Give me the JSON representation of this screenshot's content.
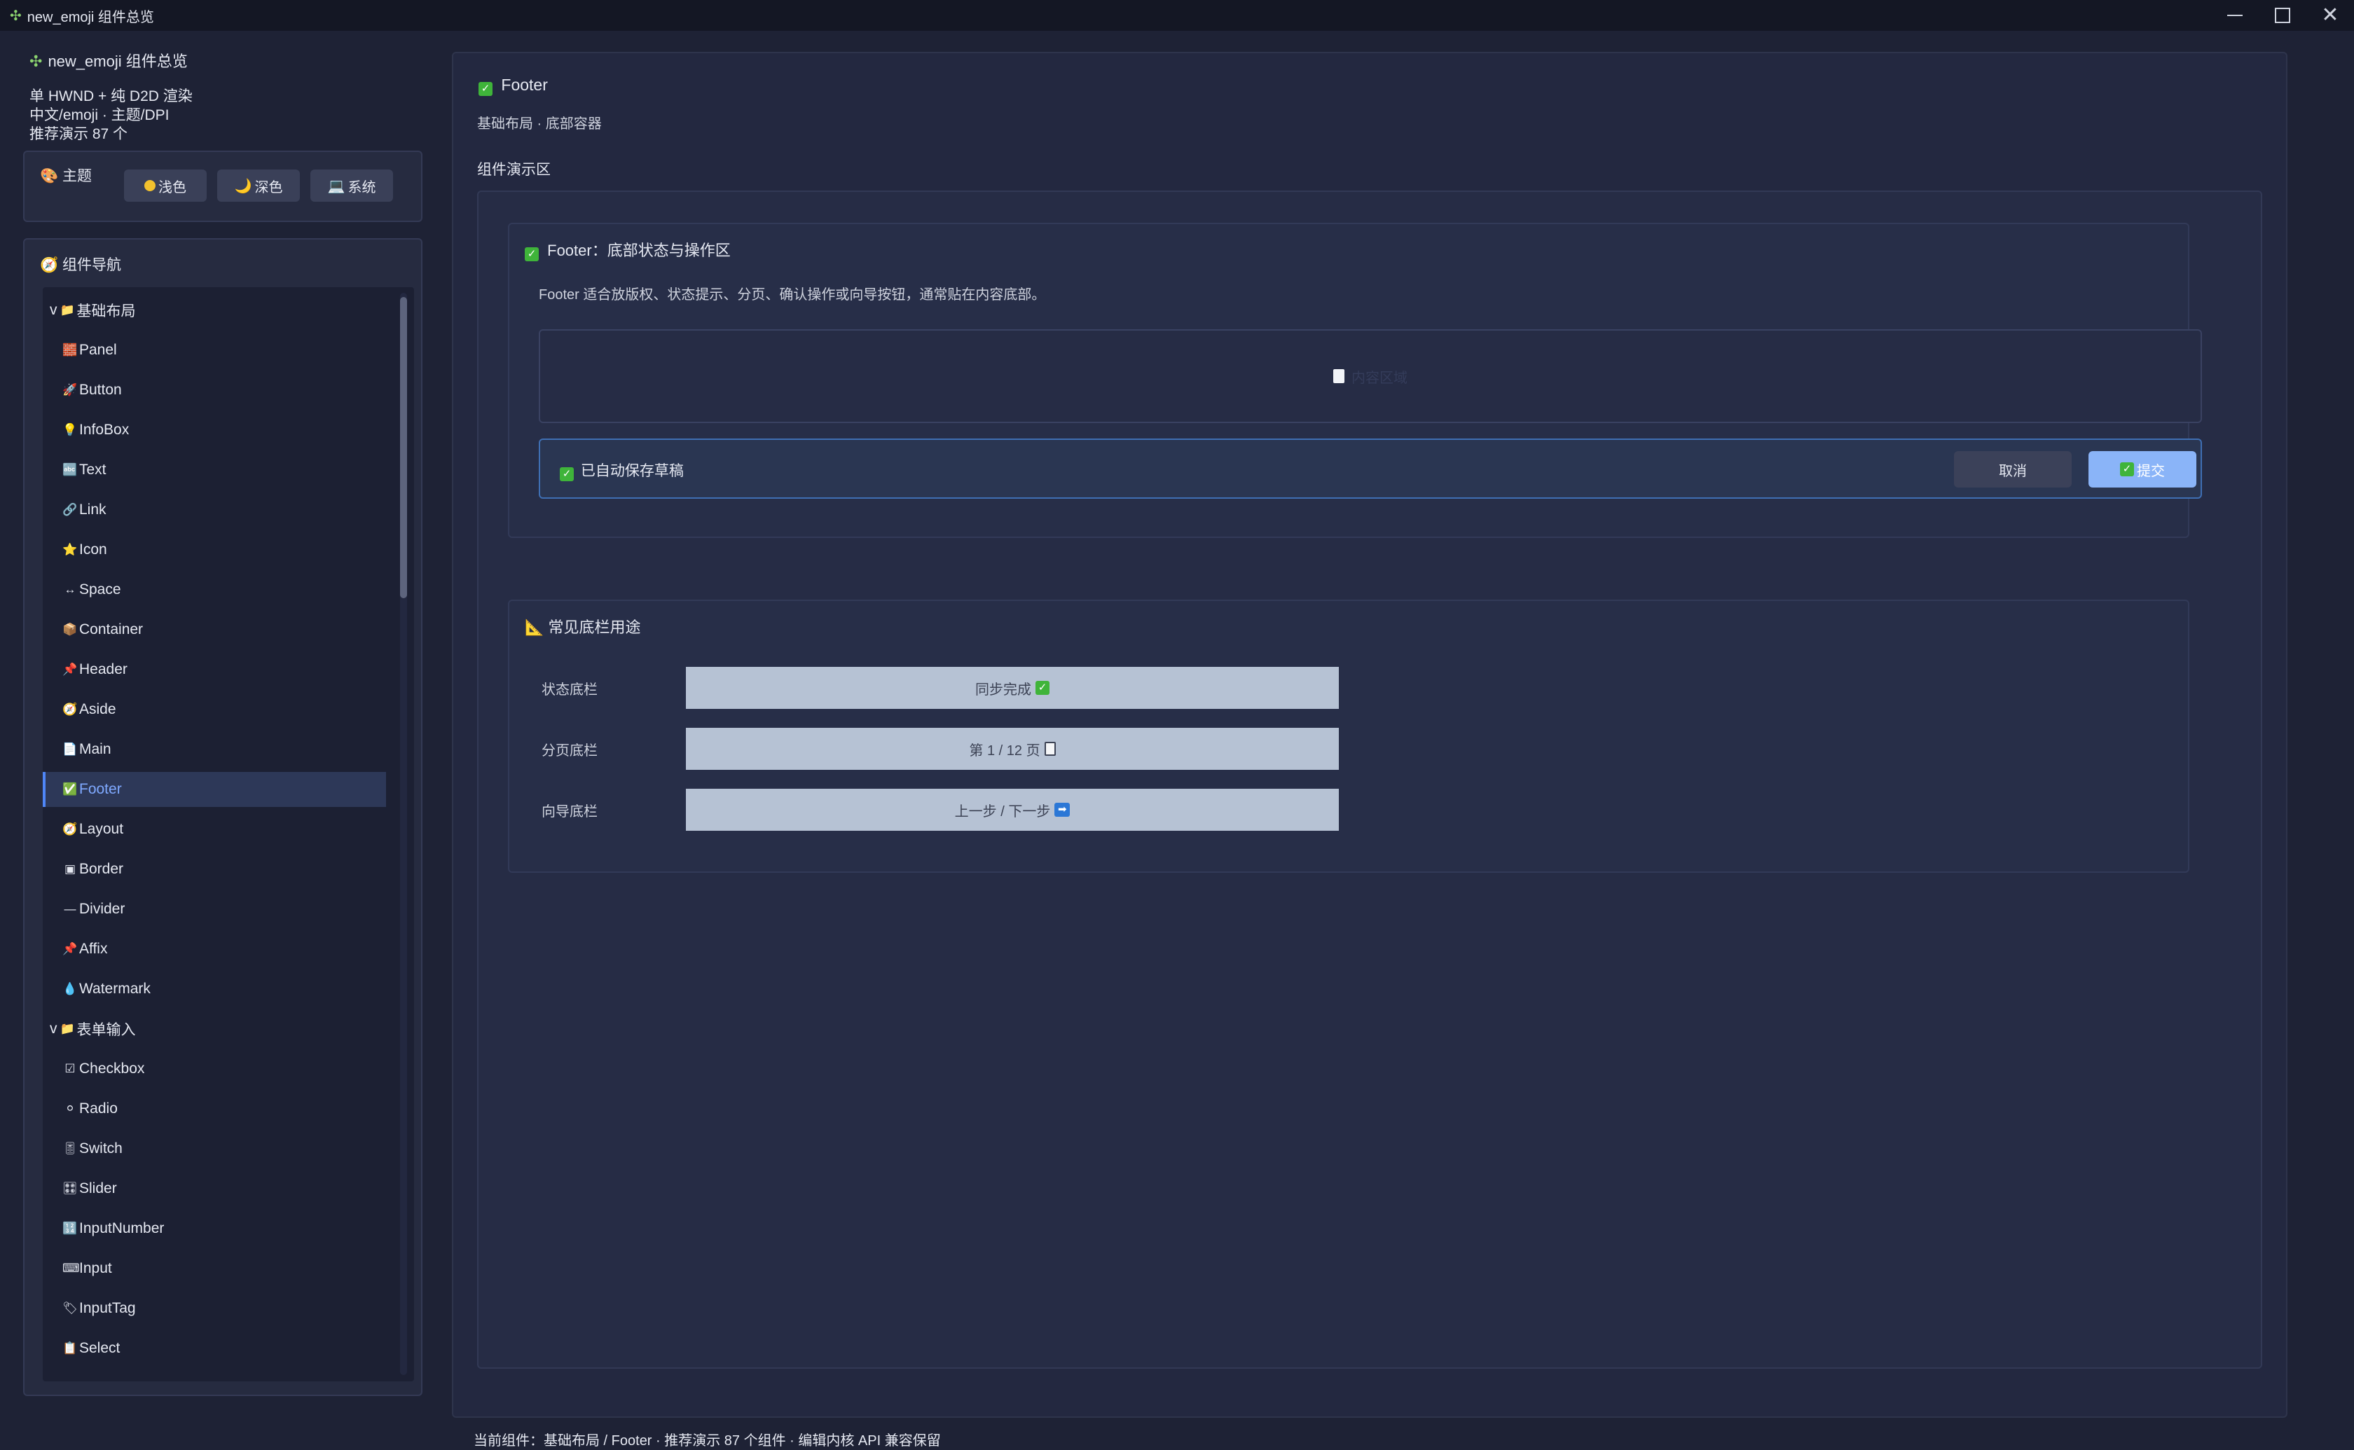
{
  "window": {
    "title": "new_emoji 组件总览",
    "app_icon": "puzzle-icon"
  },
  "sidebar": {
    "header": "new_emoji 组件总览",
    "info_lines": [
      "单 HWND + 纯 D2D 渲染",
      "中文/emoji · 主题/DPI",
      "推荐演示 87 个"
    ],
    "theme": {
      "title": "主题",
      "title_icon": "palette-icon",
      "buttons": [
        {
          "label": "浅色",
          "icon": "sun-icon"
        },
        {
          "label": "深色",
          "icon": "moon-icon"
        },
        {
          "label": "系统",
          "icon": "laptop-icon"
        }
      ]
    },
    "nav": {
      "title": "组件导航",
      "title_icon": "compass-icon",
      "items": [
        {
          "type": "group",
          "label": "基础布局",
          "prefix": "v",
          "icon": "📁"
        },
        {
          "type": "item",
          "label": "Panel",
          "icon": "🧱"
        },
        {
          "type": "item",
          "label": "Button",
          "icon": "🚀"
        },
        {
          "type": "item",
          "label": "InfoBox",
          "icon": "💡"
        },
        {
          "type": "item",
          "label": "Text",
          "icon": "🔤"
        },
        {
          "type": "item",
          "label": "Link",
          "icon": "🔗"
        },
        {
          "type": "item",
          "label": "Icon",
          "icon": "⭐"
        },
        {
          "type": "item",
          "label": "Space",
          "icon": "↔"
        },
        {
          "type": "item",
          "label": "Container",
          "icon": "📦"
        },
        {
          "type": "item",
          "label": "Header",
          "icon": "📌"
        },
        {
          "type": "item",
          "label": "Aside",
          "icon": "🧭"
        },
        {
          "type": "item",
          "label": "Main",
          "icon": "📄"
        },
        {
          "type": "item",
          "label": "Footer",
          "icon": "✅",
          "selected": true
        },
        {
          "type": "item",
          "label": "Layout",
          "icon": "🧭"
        },
        {
          "type": "item",
          "label": "Border",
          "icon": "▣"
        },
        {
          "type": "item",
          "label": "Divider",
          "icon": "—"
        },
        {
          "type": "item",
          "label": "Affix",
          "icon": "📌"
        },
        {
          "type": "item",
          "label": "Watermark",
          "icon": "💧"
        },
        {
          "type": "group",
          "label": "表单输入",
          "prefix": "v",
          "icon": "📁"
        },
        {
          "type": "item",
          "label": "Checkbox",
          "icon": "☑"
        },
        {
          "type": "item",
          "label": "Radio",
          "icon": "⚪"
        },
        {
          "type": "item",
          "label": "Switch",
          "icon": "🎚"
        },
        {
          "type": "item",
          "label": "Slider",
          "icon": "🎛"
        },
        {
          "type": "item",
          "label": "InputNumber",
          "icon": "🔢"
        },
        {
          "type": "item",
          "label": "Input",
          "icon": "⌨"
        },
        {
          "type": "item",
          "label": "InputTag",
          "icon": "🏷"
        },
        {
          "type": "item",
          "label": "Select",
          "icon": "📋"
        }
      ]
    }
  },
  "main": {
    "title": "Footer",
    "subtitle": "基础布局 · 底部容器",
    "demo_label": "组件演示区",
    "card1": {
      "title": "Footer：底部状态与操作区",
      "description": "Footer 适合放版权、状态提示、分页、确认操作或向导按钮，通常贴在内容底部。",
      "content_placeholder": "内容区域",
      "footer_status": "已自动保存草稿",
      "cancel_label": "取消",
      "submit_label": "提交"
    },
    "card2": {
      "title": "常见底栏用途",
      "title_icon": "triangle-ruler-icon",
      "rows": [
        {
          "label": "状态底栏",
          "value": "同步完成",
          "icon": "check-icon"
        },
        {
          "label": "分页底栏",
          "value": "第 1 / 12 页",
          "icon": "page-icon"
        },
        {
          "label": "向导底栏",
          "value": "上一步 / 下一步",
          "icon": "arrow-right-icon"
        }
      ]
    }
  },
  "status_bar": "当前组件：基础布局 / Footer · 推荐演示 87 个组件 · 编辑内核 API 兼容保留",
  "colors": {
    "background": "#1e2235",
    "accent": "#4f86f7",
    "selected_text": "#7fa9ff",
    "check_green": "#3fb43a",
    "submit_button": "#8ab4f8"
  }
}
